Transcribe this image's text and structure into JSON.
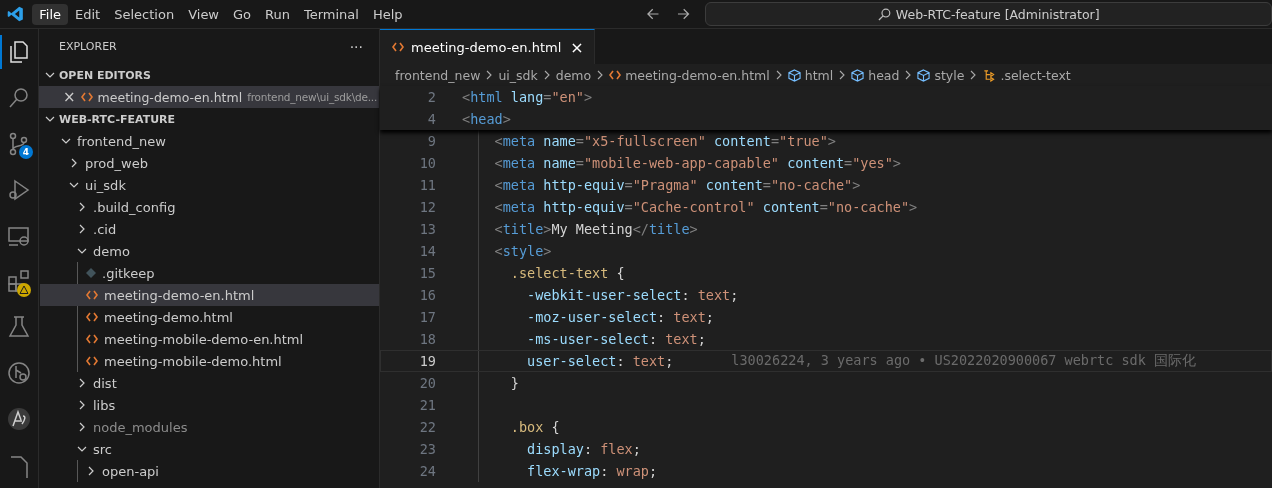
{
  "menu": [
    {
      "label": "File",
      "selected": true
    },
    {
      "label": "Edit",
      "selected": false
    },
    {
      "label": "Selection",
      "selected": false
    },
    {
      "label": "View",
      "selected": false
    },
    {
      "label": "Go",
      "selected": false
    },
    {
      "label": "Run",
      "selected": false
    },
    {
      "label": "Terminal",
      "selected": false
    },
    {
      "label": "Help",
      "selected": false
    }
  ],
  "command_center": {
    "text": "Web-RTC-feature [Administrator]"
  },
  "activity_bar": [
    {
      "kind": "files",
      "selected": true
    },
    {
      "kind": "search",
      "selected": false
    },
    {
      "kind": "scm",
      "selected": false,
      "badge": "4"
    },
    {
      "kind": "debug",
      "selected": false
    },
    {
      "kind": "remote",
      "selected": false
    },
    {
      "kind": "extensions",
      "selected": false,
      "warning": true
    },
    {
      "kind": "testing",
      "selected": false
    },
    {
      "kind": "gitgraph",
      "selected": false
    },
    {
      "kind": "ai",
      "selected": false
    },
    {
      "kind": "doc",
      "selected": false
    }
  ],
  "sidebar": {
    "title": "EXPLORER",
    "more": "···",
    "open_editors": {
      "title": "OPEN EDITORS",
      "expanded": true,
      "items": [
        {
          "close": "×",
          "name": "meeting-demo-en.html",
          "path": "frontend_new\\ui_sdk\\de...",
          "selected": true
        }
      ]
    },
    "workspace": {
      "title": "WEB-RTC-FEATURE",
      "expanded": true,
      "tree": [
        {
          "label": "frontend_new",
          "kind": "folder",
          "expanded": true,
          "selected": false,
          "ignored": false,
          "children": [
            {
              "label": "prod_web",
              "kind": "folder",
              "expanded": false,
              "selected": false,
              "ignored": false
            },
            {
              "label": "ui_sdk",
              "kind": "folder",
              "expanded": true,
              "selected": false,
              "ignored": false,
              "children": [
                {
                  "label": ".build_config",
                  "kind": "folder",
                  "expanded": false,
                  "selected": false,
                  "ignored": false
                },
                {
                  "label": ".cid",
                  "kind": "folder",
                  "expanded": false,
                  "selected": false,
                  "ignored": false
                },
                {
                  "label": "demo",
                  "kind": "folder",
                  "expanded": true,
                  "selected": false,
                  "ignored": false,
                  "children": [
                    {
                      "label": ".gitkeep",
                      "kind": "gitkeep",
                      "selected": false,
                      "ignored": false
                    },
                    {
                      "label": "meeting-demo-en.html",
                      "kind": "html",
                      "selected": true,
                      "ignored": false
                    },
                    {
                      "label": "meeting-demo.html",
                      "kind": "html",
                      "selected": false,
                      "ignored": false
                    },
                    {
                      "label": "meeting-mobile-demo-en.html",
                      "kind": "html",
                      "selected": false,
                      "ignored": false
                    },
                    {
                      "label": "meeting-mobile-demo.html",
                      "kind": "html",
                      "selected": false,
                      "ignored": false
                    }
                  ]
                },
                {
                  "label": "dist",
                  "kind": "folder",
                  "expanded": false,
                  "selected": false,
                  "ignored": false
                },
                {
                  "label": "libs",
                  "kind": "folder",
                  "expanded": false,
                  "selected": false,
                  "ignored": false
                },
                {
                  "label": "node_modules",
                  "kind": "folder",
                  "expanded": false,
                  "selected": false,
                  "ignored": true
                },
                {
                  "label": "src",
                  "kind": "folder",
                  "expanded": true,
                  "selected": false,
                  "ignored": false,
                  "children": [
                    {
                      "label": "open-api",
                      "kind": "folder",
                      "expanded": false,
                      "selected": false,
                      "ignored": false
                    }
                  ]
                }
              ]
            }
          ]
        }
      ]
    }
  },
  "tabs": [
    {
      "label": "meeting-demo-en.html",
      "close": "×",
      "selected": true
    }
  ],
  "breadcrumbs": [
    {
      "label": "frontend_new",
      "kind": "folder"
    },
    {
      "label": "ui_sdk",
      "kind": "folder"
    },
    {
      "label": "demo",
      "kind": "folder"
    },
    {
      "label": "meeting-demo-en.html",
      "kind": "html"
    },
    {
      "label": "html",
      "kind": "element"
    },
    {
      "label": "head",
      "kind": "element"
    },
    {
      "label": "style",
      "kind": "element"
    },
    {
      "label": ".select-text",
      "kind": "selector"
    }
  ],
  "sticky_lines": [
    {
      "number": "2",
      "tokens": [
        {
          "kind": "p",
          "t": "<"
        },
        {
          "kind": "tag",
          "t": "html"
        },
        {
          "kind": "attr",
          "t": " lang"
        },
        {
          "kind": "p",
          "t": "="
        },
        {
          "kind": "str",
          "t": "\"en\""
        },
        {
          "kind": "p",
          "t": ">"
        }
      ]
    },
    {
      "number": "4",
      "tokens": [
        {
          "kind": "p",
          "t": "<"
        },
        {
          "kind": "tag",
          "t": "head"
        },
        {
          "kind": "p",
          "t": ">"
        }
      ]
    }
  ],
  "lines": [
    {
      "number": "9",
      "current": false,
      "tokens": [
        {
          "kind": "p",
          "t": "    <"
        },
        {
          "kind": "tag",
          "t": "meta"
        },
        {
          "kind": "attr",
          "t": " name"
        },
        {
          "kind": "p",
          "t": "="
        },
        {
          "kind": "str",
          "t": "\"x5-fullscreen\""
        },
        {
          "kind": "attr",
          "t": " content"
        },
        {
          "kind": "p",
          "t": "="
        },
        {
          "kind": "str",
          "t": "\"true\""
        },
        {
          "kind": "p",
          "t": ">"
        }
      ]
    },
    {
      "number": "10",
      "current": false,
      "tokens": [
        {
          "kind": "p",
          "t": "    <"
        },
        {
          "kind": "tag",
          "t": "meta"
        },
        {
          "kind": "attr",
          "t": " name"
        },
        {
          "kind": "p",
          "t": "="
        },
        {
          "kind": "str",
          "t": "\"mobile-web-app-capable\""
        },
        {
          "kind": "attr",
          "t": " content"
        },
        {
          "kind": "p",
          "t": "="
        },
        {
          "kind": "str",
          "t": "\"yes\""
        },
        {
          "kind": "p",
          "t": ">"
        }
      ]
    },
    {
      "number": "11",
      "current": false,
      "tokens": [
        {
          "kind": "p",
          "t": "    <"
        },
        {
          "kind": "tag",
          "t": "meta"
        },
        {
          "kind": "attr",
          "t": " http-equiv"
        },
        {
          "kind": "p",
          "t": "="
        },
        {
          "kind": "str",
          "t": "\"Pragma\""
        },
        {
          "kind": "attr",
          "t": " content"
        },
        {
          "kind": "p",
          "t": "="
        },
        {
          "kind": "str",
          "t": "\"no-cache\""
        },
        {
          "kind": "p",
          "t": ">"
        }
      ]
    },
    {
      "number": "12",
      "current": false,
      "tokens": [
        {
          "kind": "p",
          "t": "    <"
        },
        {
          "kind": "tag",
          "t": "meta"
        },
        {
          "kind": "attr",
          "t": " http-equiv"
        },
        {
          "kind": "p",
          "t": "="
        },
        {
          "kind": "str",
          "t": "\"Cache-control\""
        },
        {
          "kind": "attr",
          "t": " content"
        },
        {
          "kind": "p",
          "t": "="
        },
        {
          "kind": "str",
          "t": "\"no-cache\""
        },
        {
          "kind": "p",
          "t": ">"
        }
      ]
    },
    {
      "number": "13",
      "current": false,
      "tokens": [
        {
          "kind": "p",
          "t": "    <"
        },
        {
          "kind": "tag",
          "t": "title"
        },
        {
          "kind": "p",
          "t": ">"
        },
        {
          "kind": "text",
          "t": "My Meeting"
        },
        {
          "kind": "p",
          "t": "</"
        },
        {
          "kind": "tag",
          "t": "title"
        },
        {
          "kind": "p",
          "t": ">"
        }
      ]
    },
    {
      "number": "14",
      "current": false,
      "tokens": [
        {
          "kind": "p",
          "t": "    <"
        },
        {
          "kind": "tag",
          "t": "style"
        },
        {
          "kind": "p",
          "t": ">"
        }
      ]
    },
    {
      "number": "15",
      "current": false,
      "tokens": [
        {
          "kind": "sel",
          "t": "      .select-text"
        },
        {
          "kind": "text",
          "t": " {"
        }
      ]
    },
    {
      "number": "16",
      "current": false,
      "tokens": [
        {
          "kind": "prop",
          "t": "        -webkit-user-select"
        },
        {
          "kind": "text",
          "t": ": "
        },
        {
          "kind": "val",
          "t": "text"
        },
        {
          "kind": "text",
          "t": ";"
        }
      ]
    },
    {
      "number": "17",
      "current": false,
      "tokens": [
        {
          "kind": "prop",
          "t": "        -moz-user-select"
        },
        {
          "kind": "text",
          "t": ": "
        },
        {
          "kind": "val",
          "t": "text"
        },
        {
          "kind": "text",
          "t": ";"
        }
      ]
    },
    {
      "number": "18",
      "current": false,
      "tokens": [
        {
          "kind": "prop",
          "t": "        -ms-user-select"
        },
        {
          "kind": "text",
          "t": ": "
        },
        {
          "kind": "val",
          "t": "text"
        },
        {
          "kind": "text",
          "t": ";"
        }
      ]
    },
    {
      "number": "19",
      "current": true,
      "blame": "l30026224, 3 years ago • US2022020900067 webrtc sdk 国际化",
      "tokens": [
        {
          "kind": "prop",
          "t": "        user-select"
        },
        {
          "kind": "text",
          "t": ": "
        },
        {
          "kind": "val",
          "t": "text"
        },
        {
          "kind": "text",
          "t": ";"
        }
      ]
    },
    {
      "number": "20",
      "current": false,
      "tokens": [
        {
          "kind": "text",
          "t": "      }"
        }
      ]
    },
    {
      "number": "21",
      "current": false
    },
    {
      "number": "22",
      "current": false,
      "tokens": [
        {
          "kind": "sel",
          "t": "      .box"
        },
        {
          "kind": "text",
          "t": " {"
        }
      ]
    },
    {
      "number": "23",
      "current": false,
      "tokens": [
        {
          "kind": "prop",
          "t": "        display"
        },
        {
          "kind": "text",
          "t": ": "
        },
        {
          "kind": "val",
          "t": "flex"
        },
        {
          "kind": "text",
          "t": ";"
        }
      ]
    },
    {
      "number": "24",
      "current": false,
      "tokens": [
        {
          "kind": "prop",
          "t": "        flex-wrap"
        },
        {
          "kind": "text",
          "t": ": "
        },
        {
          "kind": "val",
          "t": "wrap"
        },
        {
          "kind": "text",
          "t": ";"
        }
      ]
    }
  ]
}
